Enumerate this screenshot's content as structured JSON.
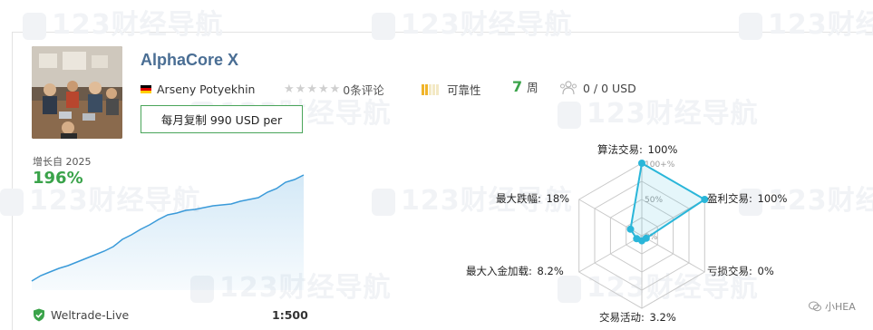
{
  "header": {
    "title": "AlphaCore X",
    "author": "Arseny Potyekhin",
    "reviews_label": "0条评论",
    "reliability_label": "可靠性",
    "weeks_value": "7",
    "weeks_unit": "周",
    "subscribers_text": "0 / 0 USD",
    "copy_button_label": "每月复制 990 USD per",
    "rating": 0,
    "reliability_level": 0.2
  },
  "growth": {
    "label": "增长自 2025",
    "value": "196%",
    "color": "#3a9ad9"
  },
  "account": {
    "broker": "Weltrade-Live",
    "leverage": "1:500"
  },
  "radar": {
    "labels": {
      "algo": "算法交易:",
      "algo_pct": "100%",
      "profit": "盈利交易:",
      "profit_pct": "100%",
      "loss": "亏损交易:",
      "loss_pct": "0%",
      "activity": "交易活动:",
      "activity_pct": "3.2%",
      "deposit_load": "最大入金加载:",
      "deposit_load_pct": "8.2%",
      "drawdown": "最大跌幅:",
      "drawdown_pct": "18%"
    },
    "ticks": {
      "t100": "100+%",
      "t50": "50%",
      "t0": "0%"
    },
    "values": [
      1.0,
      1.0,
      0.0,
      0.032,
      0.082,
      0.18
    ],
    "accent": "#2ab6d9"
  },
  "watermark_text": "123财经导航",
  "credit_text": "小HEA"
}
